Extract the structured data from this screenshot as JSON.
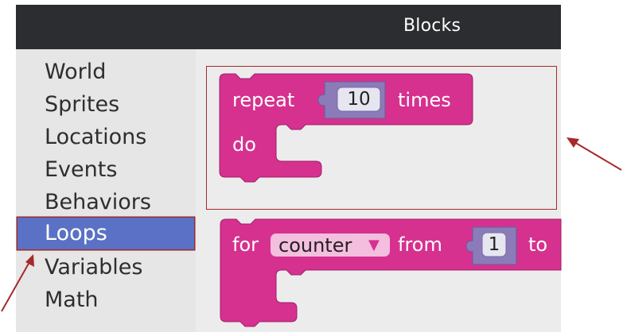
{
  "header": {
    "title": "Blocks"
  },
  "sidebar": {
    "items": [
      {
        "label": "World",
        "selected": false
      },
      {
        "label": "Sprites",
        "selected": false
      },
      {
        "label": "Locations",
        "selected": false
      },
      {
        "label": "Events",
        "selected": false
      },
      {
        "label": "Behaviors",
        "selected": false
      },
      {
        "label": "Loops",
        "selected": true
      },
      {
        "label": "Variables",
        "selected": false
      },
      {
        "label": "Math",
        "selected": false
      }
    ]
  },
  "blocks": {
    "repeat": {
      "keyword": "repeat",
      "count": "10",
      "suffix": "times",
      "do_label": "do"
    },
    "for": {
      "keyword": "for",
      "variable": "counter",
      "from_label": "from",
      "start": "1",
      "to_label": "to"
    }
  },
  "colors": {
    "header_bg": "#2b2d30",
    "sidebar_bg": "#e6e6e6",
    "selected_bg": "#5b71c5",
    "block_pink": "#d6318f",
    "number_slot": "#8b7bb8",
    "annotation_red": "#a62a2a"
  }
}
